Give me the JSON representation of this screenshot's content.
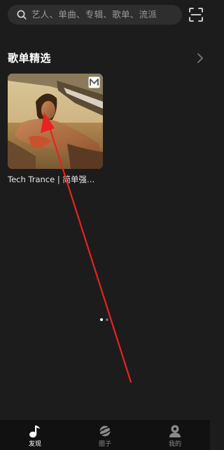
{
  "search": {
    "placeholder": "艺人、单曲、专辑、歌单、流派",
    "icon": "search-icon",
    "scan_icon": "scan-icon"
  },
  "section": {
    "title": "歌单精选",
    "more_icon": "chevron-right-icon"
  },
  "playlists": [
    {
      "title": "Tech Trance | 简单强…",
      "badge_icon": "badge-icon"
    }
  ],
  "carousel": {
    "current_page": 1,
    "page_count": 2
  },
  "bottom_nav": {
    "items": [
      {
        "label": "发现",
        "icon": "music-note-icon",
        "active": true
      },
      {
        "label": "圈子",
        "icon": "planet-icon",
        "active": false
      },
      {
        "label": "我的",
        "icon": "profile-icon",
        "active": false
      }
    ]
  },
  "colors": {
    "background": "#1c1c1c",
    "search_background": "#2e2e2e",
    "nav_background": "#111111",
    "annotation_arrow": "#e8231f"
  }
}
